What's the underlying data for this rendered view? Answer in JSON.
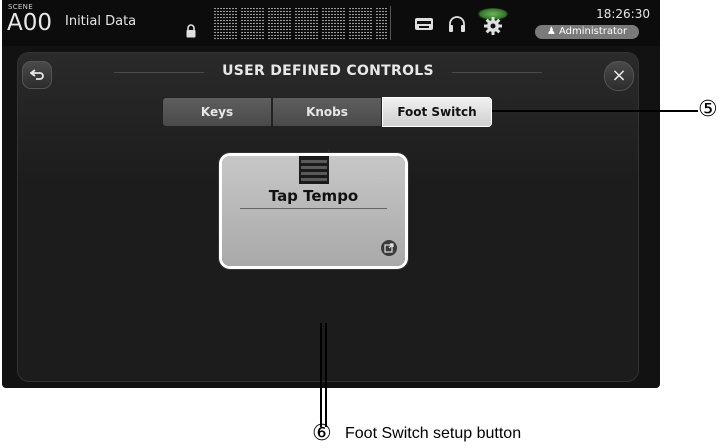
{
  "status_bar": {
    "scene_label": "SCENE",
    "scene_number": "A00",
    "scene_title": "Initial Data",
    "time": "18:26:30",
    "user": "Administrator",
    "icons": [
      "lock-icon",
      "meter-bridge",
      "recorder-icon",
      "headphones-icon",
      "gear-icon",
      "user-icon"
    ]
  },
  "panel": {
    "title": "USER DEFINED CONTROLS",
    "back_icon": "back-arrow-icon",
    "close_label": "×",
    "tabs": [
      {
        "label": "Keys",
        "active": false
      },
      {
        "label": "Knobs",
        "active": false
      },
      {
        "label": "Foot Switch",
        "active": true
      }
    ],
    "foot_switch": {
      "label": "Tap Tempo",
      "edit_icon": "popup-edit-icon"
    }
  },
  "callouts": {
    "c5": {
      "number": "⑤"
    },
    "c6": {
      "number": "⑥",
      "caption": "Foot Switch setup button"
    }
  },
  "colors": {
    "active_tab": "#e0e0e0",
    "tab": "#555555",
    "panel_bg": "#1c1c1c",
    "gear_glow": "#6fcf5a"
  }
}
